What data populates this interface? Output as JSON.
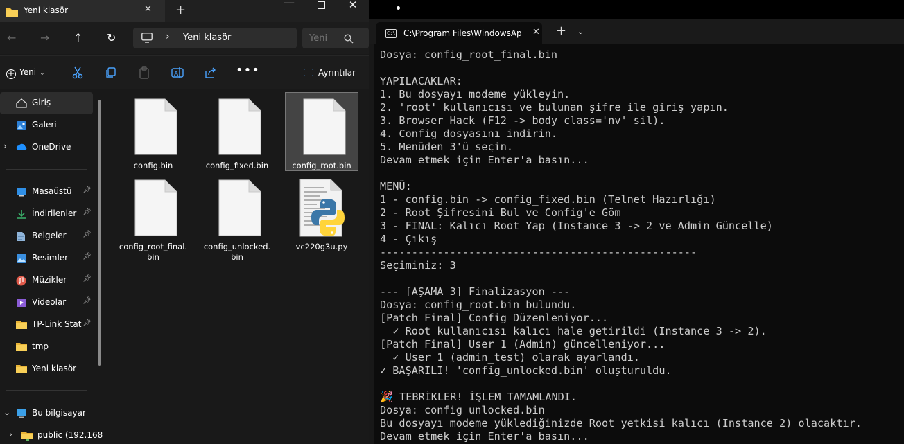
{
  "explorer": {
    "tab_title": "Yeni klasör",
    "address_path": "Yeni klasör",
    "search_placeholder": "Yeni",
    "toolbar": {
      "new_label": "Yeni",
      "details_label": "Ayrıntılar"
    },
    "nav": {
      "items": [
        {
          "label": "Giriş",
          "icon": "home-icon",
          "selected": true
        },
        {
          "label": "Galeri",
          "icon": "gallery-icon"
        },
        {
          "label": "OneDrive",
          "icon": "cloud-icon"
        },
        {
          "label": "Masaüstü",
          "icon": "desktop-icon",
          "pinned": true
        },
        {
          "label": "İndirilenler",
          "icon": "download-icon",
          "pinned": true
        },
        {
          "label": "Belgeler",
          "icon": "documents-icon",
          "pinned": true
        },
        {
          "label": "Resimler",
          "icon": "pictures-icon",
          "pinned": true
        },
        {
          "label": "Müzikler",
          "icon": "music-icon",
          "pinned": true
        },
        {
          "label": "Videolar",
          "icon": "videos-icon",
          "pinned": true
        },
        {
          "label": "TP-Link Stat",
          "icon": "folder-icon",
          "pinned": true
        },
        {
          "label": "tmp",
          "icon": "folder-icon"
        },
        {
          "label": "Yeni klasör",
          "icon": "folder-icon"
        },
        {
          "label": "Bu bilgisayar",
          "icon": "pc-icon"
        },
        {
          "label": "public (192.168",
          "icon": "network-folder-icon"
        }
      ]
    },
    "files": [
      {
        "name": "config.bin",
        "icon": "document-icon"
      },
      {
        "name": "config_fixed.bin",
        "icon": "document-icon"
      },
      {
        "name": "config_root.bin",
        "icon": "document-icon",
        "selected": true
      },
      {
        "name": "config_root_final.\nbin",
        "icon": "document-icon"
      },
      {
        "name": "config_unlocked.\nbin",
        "icon": "document-icon"
      },
      {
        "name": "vc220g3u.py",
        "icon": "python-file-icon"
      }
    ]
  },
  "terminal": {
    "tab_title": "C:\\Program Files\\WindowsAp",
    "lines": [
      "Dosya: config_root_final.bin",
      "",
      "YAPILACAKLAR:",
      "1. Bu dosyayı modeme yükleyin.",
      "2. 'root' kullanıcısı ve bulunan şifre ile giriş yapın.",
      "3. Browser Hack (F12 -> body class='nv' sil).",
      "4. Config dosyasını indirin.",
      "5. Menüden 3'ü seçin.",
      "Devam etmek için Enter'a basın...",
      "",
      "MENÜ:",
      "1 - config.bin -> config_fixed.bin (Telnet Hazırlığı)",
      "2 - Root Şifresini Bul ve Config'e Göm",
      "3 - FINAL: Kalıcı Root Yap (Instance 3 -> 2 ve Admin Güncelle)",
      "4 - Çıkış",
      "--------------------------------------------------",
      "Seçiminiz: 3",
      "",
      "--- [AŞAMA 3] Finalizasyon ---",
      "Dosya: config_root.bin bulundu.",
      "[Patch Final] Config Düzenleniyor...",
      "  ✓ Root kullanıcısı kalıcı hale getirildi (Instance 3 -> 2).",
      "[Patch Final] User 1 (Admin) güncelleniyor...",
      "  ✓ User 1 (admin_test) olarak ayarlandı.",
      "✓ BAŞARILI! 'config_unlocked.bin' oluşturuldu.",
      "",
      "🎉 TEBRİKLER! İŞLEM TAMAMLANDI.",
      "Dosya: config_unlocked.bin",
      "Bu dosyayı modeme yüklediğinizde Root yetkisi kalıcı (Instance 2) olacaktır.",
      "Devam etmek için Enter'a basın..."
    ]
  },
  "colors": {
    "explorer_bg": "#191919",
    "terminal_bg": "#0c0c0c",
    "terminal_text": "#cccccc",
    "folder_yellow": "#f3c03f",
    "accent_blue": "#4aa3ff"
  }
}
